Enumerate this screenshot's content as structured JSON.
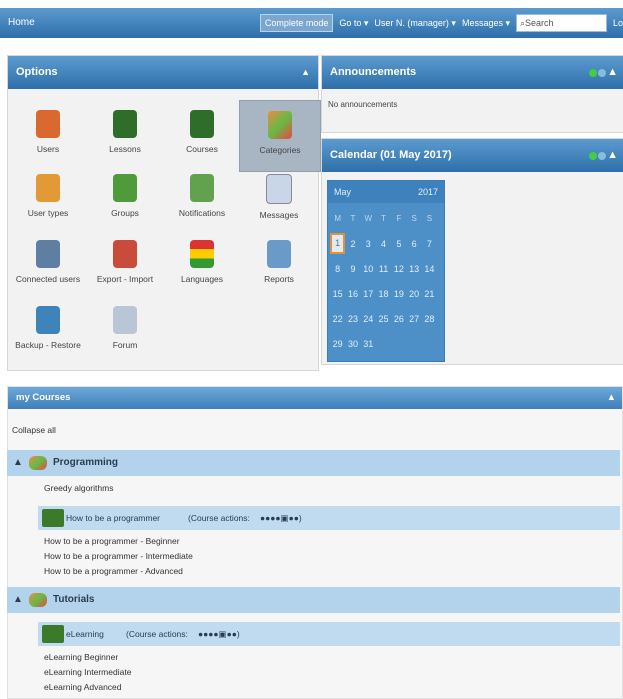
{
  "topbar": {
    "home": "Home",
    "mode": "Complete mode",
    "goto": "Go to ▾",
    "user": "User N. (manager) ▾",
    "messages": "Messages ▾",
    "search_placeholder": "Search",
    "logout": "Logout"
  },
  "options": {
    "title": "Options",
    "items": [
      "Users",
      "Lessons",
      "Courses",
      "Categories",
      "User types",
      "Groups",
      "Notifications",
      "Messages",
      "Connected users",
      "Export - Import",
      "Languages",
      "Reports",
      "Backup - Restore",
      "Forum"
    ]
  },
  "announcements": {
    "title": "Announcements",
    "body": "No announcements"
  },
  "calendar": {
    "title": "Calendar (01 May 2017)",
    "month": "May",
    "year": "2017",
    "dow": [
      "M",
      "T",
      "W",
      "T",
      "F",
      "S",
      "S"
    ],
    "days": [
      "1",
      "2",
      "3",
      "4",
      "5",
      "6",
      "7",
      "8",
      "9",
      "10",
      "11",
      "12",
      "13",
      "14",
      "15",
      "16",
      "17",
      "18",
      "19",
      "20",
      "21",
      "22",
      "23",
      "24",
      "25",
      "26",
      "27",
      "28",
      "29",
      "30",
      "31"
    ]
  },
  "courses": {
    "title": "my Courses",
    "collapse": "Collapse all",
    "categories": [
      {
        "name": "Programming",
        "plain": "Greedy algorithms",
        "course": "How to be a programmer",
        "actions": "(Course actions:",
        "lessons": [
          "How to be a programmer - Beginner",
          "How to be a programmer - Intermediate",
          "How to be a programmer - Advanced"
        ]
      },
      {
        "name": "Tutorials",
        "course": "eLearning",
        "actions": "(Course actions:",
        "lessons": [
          "eLearning Beginner",
          "eLearning Intermediate",
          "eLearning Advanced"
        ]
      }
    ]
  },
  "colors": {
    "header_blue": "#2f6fa9",
    "light_blue": "#b3d2ec"
  }
}
